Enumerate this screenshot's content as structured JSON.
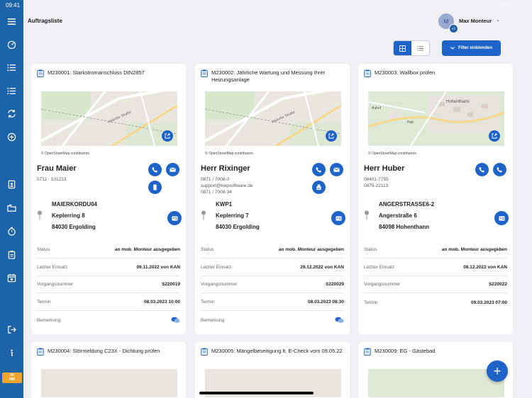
{
  "status_bar": {
    "time": "09:41",
    "right": "100%"
  },
  "header": {
    "title": "Auftragsliste"
  },
  "user": {
    "initial": "M",
    "badge": "+1",
    "name": "Max Monteur"
  },
  "sidebar": {
    "items": [
      "dashboard-icon",
      "list-icon",
      "list-icon",
      "sync-icon",
      "plus-circle-icon",
      "contact-icon",
      "folders-icon",
      "timer-icon",
      "clipboard-icon",
      "calendar-icon",
      "logout-icon",
      "info-icon"
    ],
    "badge": {
      "line1": "02",
      "line2": "MM",
      "color": "#f3a52a"
    }
  },
  "toolbar": {
    "filter_label": "Filter einblenden"
  },
  "colors": {
    "accent": "#1d63c8",
    "sidebar": "#1d63a8"
  },
  "cards": [
    {
      "title": "M230001: Starkstromanschluss DIN2857",
      "osm": "© OpenStreetMap contributors",
      "name": "Frau Maier",
      "phones": [
        "0711 - 101213"
      ],
      "address": [
        "MAIERKORDU04",
        "Keplerring 8",
        "84030 Ergolding"
      ],
      "rows": [
        {
          "label": "Status",
          "value": "an mob. Monteur ausgegeben"
        },
        {
          "label": "Letzter Einsatz",
          "value": "09.11.2022 von KAN"
        },
        {
          "label": "Vorgangsnummer",
          "value": "S220019"
        },
        {
          "label": "Termin",
          "value": "08.03.2023 10:00"
        },
        {
          "label": "Bemerkung",
          "value": ""
        }
      ]
    },
    {
      "title": "M230002: Jährliche Wartung und Messung Ihrer Heizungsanlage",
      "osm": "© OpenStreetMap contributors",
      "name": "Herr Rixinger",
      "phones": [
        "0871 / 7008-0",
        "support@kwpsoftware.de",
        "0871 / 7008-34"
      ],
      "address": [
        "KWP1",
        "Keplerring 7",
        "84030 Ergolding"
      ],
      "rows": [
        {
          "label": "Status",
          "value": "an mob. Monteur ausgegeben"
        },
        {
          "label": "Letzter Einsatz",
          "value": "29.12.2022 von KAN"
        },
        {
          "label": "Vorgangsnummer",
          "value": "S220029"
        },
        {
          "label": "Termin",
          "value": "08.03.2023 08:30"
        },
        {
          "label": "Bemerkung",
          "value": ""
        }
      ]
    },
    {
      "title": "M230003: Wallbox prüfen",
      "osm": "© OpenStreetMap contributors",
      "name": "Herr Huber",
      "phones": [
        "08401-7755",
        "0875-22113"
      ],
      "address": [
        "ANGERSTRASSE6-2",
        "Angerstraße 6",
        "84098 Hohenthann"
      ],
      "rows": [
        {
          "label": "Status",
          "value": "an mob. Monteur ausgegeben"
        },
        {
          "label": "Letzter Einsatz",
          "value": "08.12.2022 von KAN"
        },
        {
          "label": "Vorgangsnummer",
          "value": "S220022"
        },
        {
          "label": "Termin",
          "value": "09.03.2023 07:00"
        }
      ]
    }
  ],
  "bottom_cards": [
    {
      "title": "M230004: Störmeldung C23X - Dichtung prüfen"
    },
    {
      "title": "M230005: Mängelbeseitigung lt. E-Check vom 09.05.22"
    },
    {
      "title": "M230009: EG - Gästebad"
    }
  ],
  "map_labels": {
    "street": "Altdorfer Straße",
    "town": "Hohenthann",
    "village1": "Hub",
    "village2": "Auhof"
  },
  "fab_label": "+"
}
